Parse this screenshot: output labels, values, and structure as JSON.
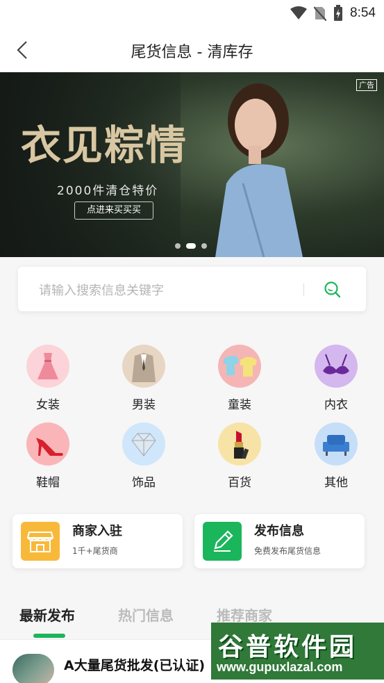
{
  "status_bar": {
    "time": "8:54",
    "icons": [
      "wifi-icon",
      "no-sim-icon",
      "battery-charging-icon"
    ]
  },
  "header": {
    "title": "尾货信息 - 清库存",
    "back_icon": "chevron-left-icon"
  },
  "banner": {
    "ad_tag": "广告",
    "headline": "衣见粽情",
    "subtitle": "2000件清仓特价",
    "button": "点进来买买买",
    "slides": 3,
    "active_slide": 2
  },
  "search": {
    "placeholder": "请输入搜索信息关键字",
    "icon": "search-icon",
    "accent": "#1bb55c"
  },
  "categories": [
    {
      "label": "女装",
      "icon": "dress-icon",
      "bg": "#fbd3d8"
    },
    {
      "label": "男装",
      "icon": "suit-icon",
      "bg": "#e8d6c4"
    },
    {
      "label": "童装",
      "icon": "kids-clothes-icon",
      "bg": "#f6b5b5"
    },
    {
      "label": "内衣",
      "icon": "bra-icon",
      "bg": "#d4b7ee"
    },
    {
      "label": "鞋帽",
      "icon": "high-heel-icon",
      "bg": "#f9b5b8"
    },
    {
      "label": "饰品",
      "icon": "diamond-icon",
      "bg": "#cfe6fb"
    },
    {
      "label": "百货",
      "icon": "lipstick-icon",
      "bg": "#f7e3a6"
    },
    {
      "label": "其他",
      "icon": "sofa-icon",
      "bg": "#c6def7"
    }
  ],
  "cards": [
    {
      "title": "商家入驻",
      "subtitle": "1千+尾货商",
      "icon": "store-icon",
      "color": "#f8b93a"
    },
    {
      "title": "发布信息",
      "subtitle": "免费发布尾货信息",
      "icon": "pencil-icon",
      "color": "#1bb55c"
    }
  ],
  "tabs": [
    {
      "label": "最新发布",
      "active": true
    },
    {
      "label": "热门信息",
      "active": false
    },
    {
      "label": "推荐商家",
      "active": false
    }
  ],
  "list": [
    {
      "title": "A大量尾货批发(已认证)"
    }
  ],
  "watermark": {
    "big": "谷普软件园",
    "small": "www.gupuxlazal.com"
  }
}
